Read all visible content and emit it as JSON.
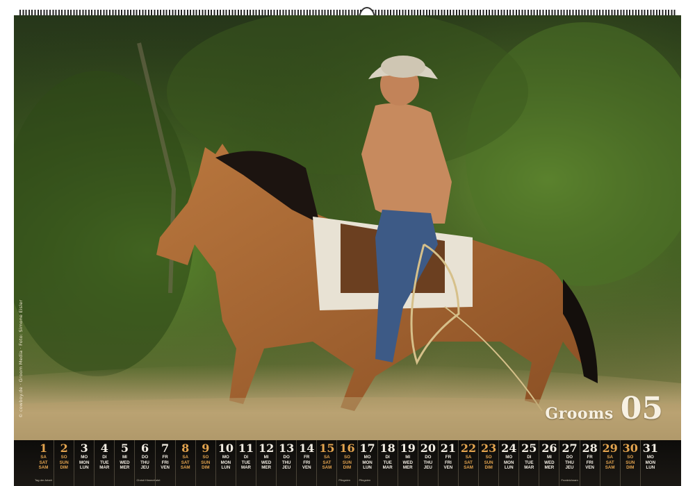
{
  "calendar": {
    "title": "Grooms",
    "month": "05",
    "credit": "© cowboy.de · Groom Media · Foto: Simone Eisler",
    "days": [
      {
        "num": "1",
        "lbl": [
          "SA",
          "SAT",
          "SAM"
        ],
        "weekend": true,
        "hol": "Tag der Arbeit"
      },
      {
        "num": "2",
        "lbl": [
          "SO",
          "SUN",
          "DIM"
        ],
        "weekend": true,
        "hol": ""
      },
      {
        "num": "3",
        "lbl": [
          "MO",
          "MON",
          "LUN"
        ],
        "weekend": false,
        "hol": ""
      },
      {
        "num": "4",
        "lbl": [
          "DI",
          "TUE",
          "MAR"
        ],
        "weekend": false,
        "hol": ""
      },
      {
        "num": "5",
        "lbl": [
          "MI",
          "WED",
          "MER"
        ],
        "weekend": false,
        "hol": ""
      },
      {
        "num": "6",
        "lbl": [
          "DO",
          "THU",
          "JEU"
        ],
        "weekend": false,
        "hol": "Christi Himmelfahrt"
      },
      {
        "num": "7",
        "lbl": [
          "FR",
          "FRI",
          "VEN"
        ],
        "weekend": false,
        "hol": ""
      },
      {
        "num": "8",
        "lbl": [
          "SA",
          "SAT",
          "SAM"
        ],
        "weekend": true,
        "hol": ""
      },
      {
        "num": "9",
        "lbl": [
          "SO",
          "SUN",
          "DIM"
        ],
        "weekend": true,
        "hol": ""
      },
      {
        "num": "10",
        "lbl": [
          "MO",
          "MON",
          "LUN"
        ],
        "weekend": false,
        "hol": ""
      },
      {
        "num": "11",
        "lbl": [
          "DI",
          "TUE",
          "MAR"
        ],
        "weekend": false,
        "hol": ""
      },
      {
        "num": "12",
        "lbl": [
          "MI",
          "WED",
          "MER"
        ],
        "weekend": false,
        "hol": ""
      },
      {
        "num": "13",
        "lbl": [
          "DO",
          "THU",
          "JEU"
        ],
        "weekend": false,
        "hol": ""
      },
      {
        "num": "14",
        "lbl": [
          "FR",
          "FRI",
          "VEN"
        ],
        "weekend": false,
        "hol": ""
      },
      {
        "num": "15",
        "lbl": [
          "SA",
          "SAT",
          "SAM"
        ],
        "weekend": true,
        "hol": ""
      },
      {
        "num": "16",
        "lbl": [
          "SO",
          "SUN",
          "DIM"
        ],
        "weekend": true,
        "hol": "Pfingsten"
      },
      {
        "num": "17",
        "lbl": [
          "MO",
          "MON",
          "LUN"
        ],
        "weekend": false,
        "hol": "Pfingsten"
      },
      {
        "num": "18",
        "lbl": [
          "DI",
          "TUE",
          "MAR"
        ],
        "weekend": false,
        "hol": ""
      },
      {
        "num": "19",
        "lbl": [
          "MI",
          "WED",
          "MER"
        ],
        "weekend": false,
        "hol": ""
      },
      {
        "num": "20",
        "lbl": [
          "DO",
          "THU",
          "JEU"
        ],
        "weekend": false,
        "hol": ""
      },
      {
        "num": "21",
        "lbl": [
          "FR",
          "FRI",
          "VEN"
        ],
        "weekend": false,
        "hol": ""
      },
      {
        "num": "22",
        "lbl": [
          "SA",
          "SAT",
          "SAM"
        ],
        "weekend": true,
        "hol": ""
      },
      {
        "num": "23",
        "lbl": [
          "SO",
          "SUN",
          "DIM"
        ],
        "weekend": true,
        "hol": ""
      },
      {
        "num": "24",
        "lbl": [
          "MO",
          "MON",
          "LUN"
        ],
        "weekend": false,
        "hol": ""
      },
      {
        "num": "25",
        "lbl": [
          "DI",
          "TUE",
          "MAR"
        ],
        "weekend": false,
        "hol": ""
      },
      {
        "num": "26",
        "lbl": [
          "MI",
          "WED",
          "MER"
        ],
        "weekend": false,
        "hol": ""
      },
      {
        "num": "27",
        "lbl": [
          "DO",
          "THU",
          "JEU"
        ],
        "weekend": false,
        "hol": "Fronleichnam"
      },
      {
        "num": "28",
        "lbl": [
          "FR",
          "FRI",
          "VEN"
        ],
        "weekend": false,
        "hol": ""
      },
      {
        "num": "29",
        "lbl": [
          "SA",
          "SAT",
          "SAM"
        ],
        "weekend": true,
        "hol": ""
      },
      {
        "num": "30",
        "lbl": [
          "SO",
          "SUN",
          "DIM"
        ],
        "weekend": true,
        "hol": ""
      },
      {
        "num": "31",
        "lbl": [
          "MO",
          "MON",
          "LUN"
        ],
        "weekend": false,
        "hol": ""
      }
    ]
  },
  "colors": {
    "weekend": "#e3a44f",
    "text": "#f2ede3",
    "bar": "#0d0c0a"
  },
  "photo": {
    "icon": "cowboy-on-horse-photo"
  }
}
